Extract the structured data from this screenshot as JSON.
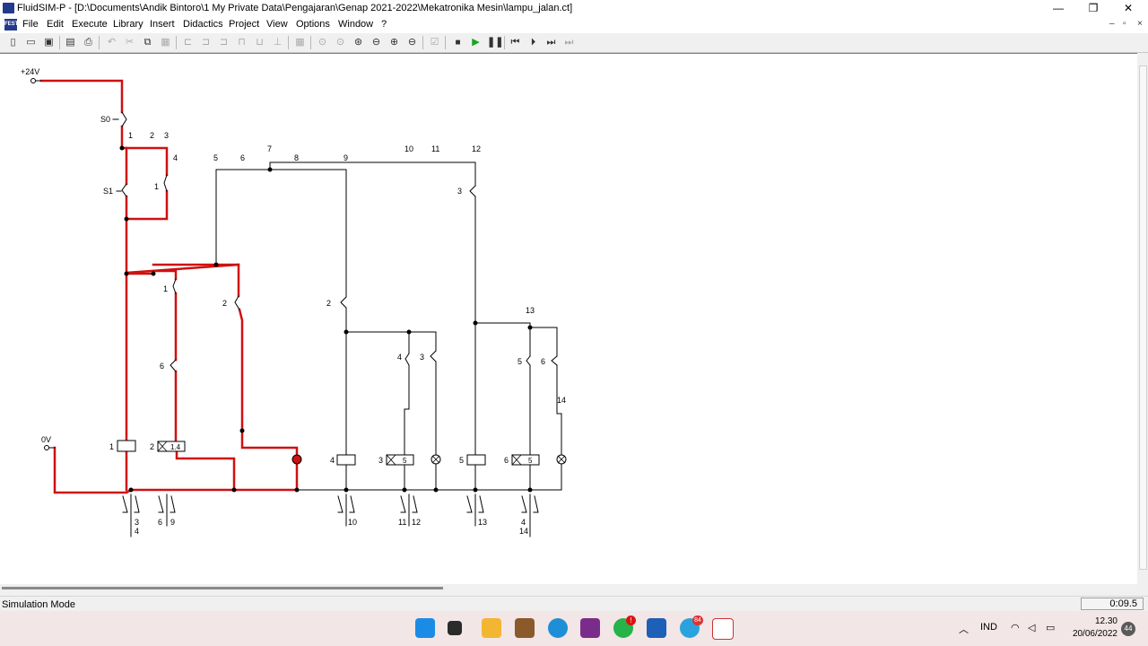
{
  "window": {
    "title": "FluidSIM-P - [D:\\Documents\\Andik Bintoro\\1 My Private Data\\Pengajaran\\Genap 2021-2022\\Mekatronika Mesin\\lampu_jalan.ct]",
    "controls": [
      "—",
      "❐",
      "✕"
    ]
  },
  "menu": {
    "mdi_icon": "FESTO",
    "items": [
      "File",
      "Edit",
      "Execute",
      "Library",
      "Insert",
      "Didactics",
      "Project",
      "View",
      "Options",
      "Window",
      "?"
    ],
    "mdi_controls": [
      "–",
      "▫",
      "×"
    ]
  },
  "toolbar": {
    "icons": [
      "new-icon",
      "open-icon",
      "save-icon",
      "print-preview-icon",
      "print-icon",
      "undo-icon",
      "cut-icon",
      "copy-icon",
      "paste-icon",
      "align-left-icon",
      "align-center-icon",
      "align-right-icon",
      "align-top-icon",
      "align-middle-icon",
      "align-bottom-icon",
      "grid-icon",
      "zoom-fit-icon",
      "zoom-window-icon",
      "zoom-all-icon",
      "zoom-previous-icon",
      "zoom-in-icon",
      "zoom-out-icon",
      "check-icon",
      "stop-icon",
      "play-icon",
      "pause-icon",
      "reset-icon",
      "step-icon",
      "step-forward-icon",
      "fast-forward-icon"
    ]
  },
  "colors": {
    "active_wire": "#d01010",
    "wire": "#000000",
    "active_node": "#cc1111"
  },
  "diagram": {
    "supply_plus": "+24V",
    "supply_zero": "0V",
    "switch_labels": [
      "S0",
      "S1"
    ],
    "column_numbers": [
      "1",
      "2",
      "3",
      "4",
      "5",
      "6",
      "7",
      "8",
      "9",
      "10",
      "11",
      "12",
      "13",
      "14"
    ],
    "contact_labels": [
      "1",
      "2",
      "6",
      "2",
      "4",
      "3",
      "3",
      "5",
      "6"
    ],
    "coil_labels": [
      "1",
      "2",
      "4",
      "3",
      "5",
      "6"
    ],
    "timer_values": [
      "1.4",
      "5",
      "5"
    ],
    "contact_table": [
      {
        "contacts": "3\n4"
      },
      {
        "contacts": "6 9"
      },
      {
        "contacts": "10"
      },
      {
        "contacts": "11 12"
      },
      {
        "contacts": "13"
      },
      {
        "contacts": "4\n14"
      }
    ]
  },
  "status": {
    "mode": "Simulation Mode",
    "time": "0:09.5"
  },
  "taskbar": {
    "apps": [
      "windows-start-icon",
      "task-view-icon",
      "file-explorer-icon",
      "library-icon",
      "edge-icon",
      "ocr-app-icon",
      "whatsapp-icon",
      "word-icon",
      "telegram-icon",
      "fluidsim-icon"
    ],
    "whatsapp_badge": "!",
    "telegram_badge": "84",
    "lang": "IND",
    "time": "12.30",
    "date": "20/06/2022",
    "notifications": "44"
  }
}
